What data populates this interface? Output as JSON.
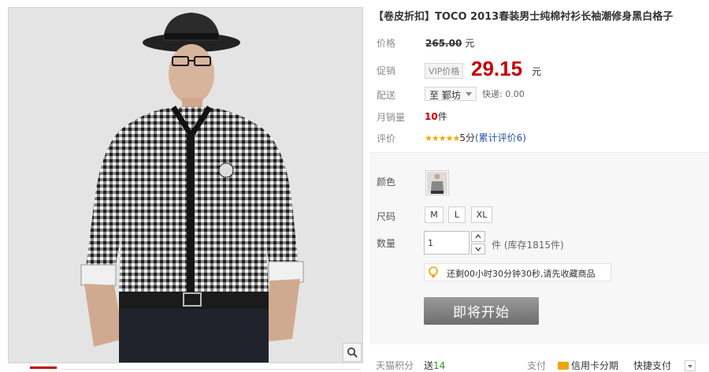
{
  "product": {
    "title": "【卷皮折扣】TOCO 2013春装男士纯棉衬衫长袖潮修身黑白格子"
  },
  "price": {
    "label": "价格",
    "original": "265.00",
    "unit": "元"
  },
  "promo": {
    "label": "促销",
    "vip_tag": "VIP价格",
    "price": "29.15",
    "unit": "元"
  },
  "delivery": {
    "label": "配送",
    "destination": "至 鄞坊",
    "express": "快递: 0.00"
  },
  "monthly_sales": {
    "label": "月销量",
    "count": "10",
    "unit": "件"
  },
  "rating": {
    "label": "评价",
    "stars": "★★★★★",
    "score": "5分",
    "reviews_link": "(累计评价6)"
  },
  "options": {
    "color_label": "颜色",
    "size_label": "尺码",
    "sizes": [
      "M",
      "L",
      "XL"
    ],
    "qty_label": "数量",
    "qty_value": "1",
    "stock_text": "件 (库存1815件)",
    "notice": "还剩00小时30分钟30秒,请先收藏商品",
    "buy_button": "即将开始"
  },
  "footer": {
    "points_label": "天猫积分",
    "points_text": "送",
    "points_value": "14",
    "pay_label": "支付",
    "installment": "信用卡分期",
    "quick_pay": "快捷支付"
  },
  "colors": {
    "price_red": "#c40000",
    "star_gold": "#f2a900",
    "link_blue": "#2953a6",
    "button_gray": "#7b7b7b"
  }
}
